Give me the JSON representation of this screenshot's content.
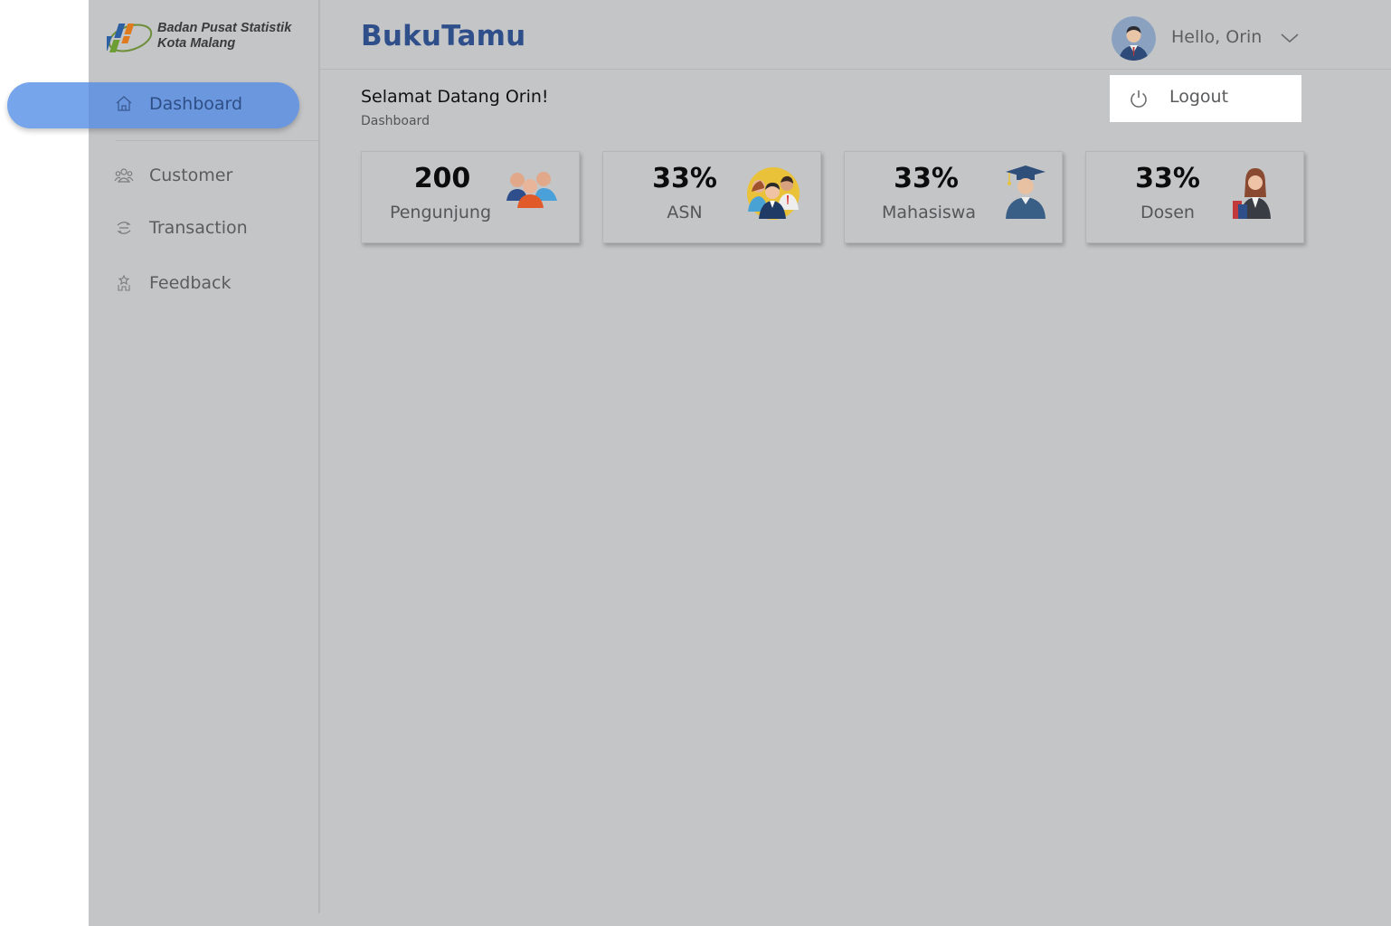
{
  "brand": {
    "line1": "Badan Pusat Statistik",
    "line2": "Kota Malang"
  },
  "sidebar": {
    "items": [
      {
        "label": "Dashboard",
        "icon": "home-icon",
        "active": true
      },
      {
        "label": "Customer",
        "icon": "users-icon",
        "active": false
      },
      {
        "label": "Transaction",
        "icon": "transaction-icon",
        "active": false
      },
      {
        "label": "Feedback",
        "icon": "feedback-icon",
        "active": false
      }
    ]
  },
  "header": {
    "title": "BukuTamu",
    "greeting": "Hello, Orin"
  },
  "main": {
    "welcome": "Selamat Datang Orin!",
    "breadcrumb": "Dashboard",
    "cards": [
      {
        "value": "200",
        "label": "Pengunjung",
        "icon": "group-people-icon"
      },
      {
        "value": "33%",
        "label": "ASN",
        "icon": "civil-servants-icon"
      },
      {
        "value": "33%",
        "label": "Mahasiswa",
        "icon": "graduate-icon"
      },
      {
        "value": "33%",
        "label": "Dosen",
        "icon": "lecturer-icon"
      }
    ]
  },
  "dropdown": {
    "logout_label": "Logout"
  },
  "colors": {
    "overlay_bg": "#c4c5c7",
    "accent": "#76a5ec",
    "title": "#2f4f8a"
  }
}
